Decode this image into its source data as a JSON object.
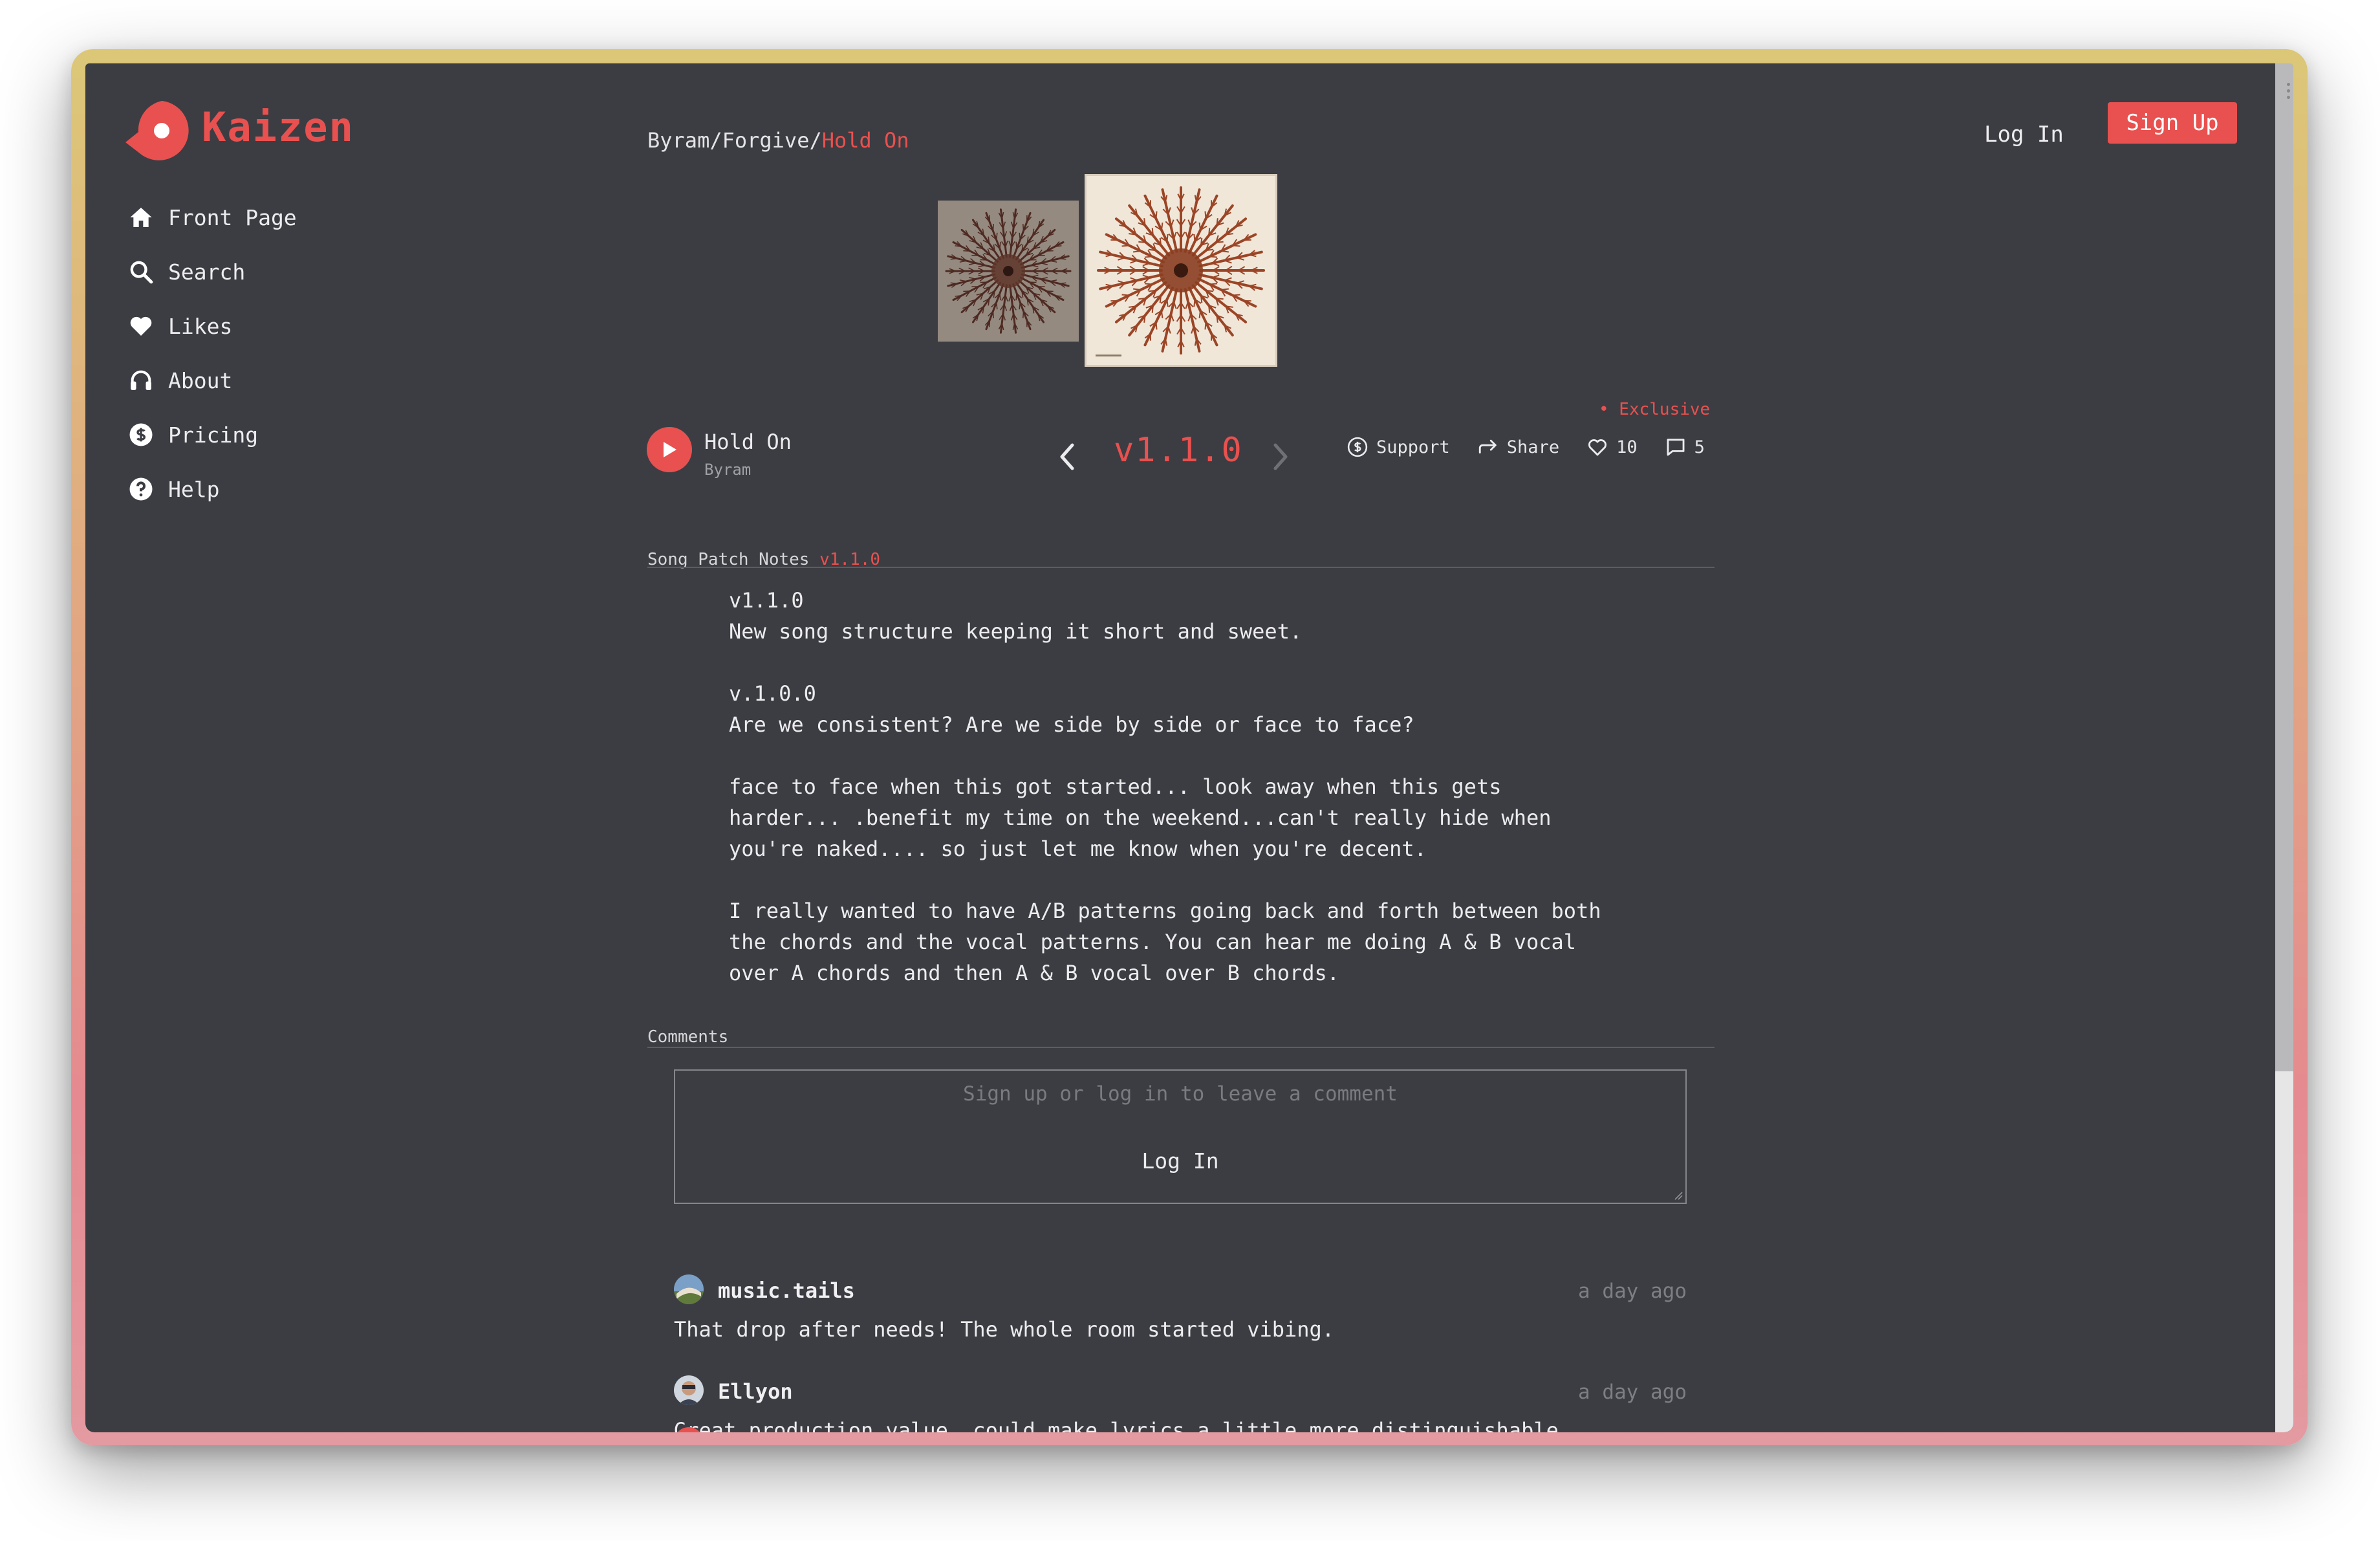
{
  "app": {
    "name": "Kaizen",
    "brand_color": "#e8514f",
    "logo_icon": "kaizen-logo-icon"
  },
  "sidebar": {
    "items": [
      {
        "label": "Front Page",
        "icon": "home-icon"
      },
      {
        "label": "Search",
        "icon": "search-icon"
      },
      {
        "label": "Likes",
        "icon": "heart-icon"
      },
      {
        "label": "About",
        "icon": "headphones-icon"
      },
      {
        "label": "Pricing",
        "icon": "dollar-icon"
      },
      {
        "label": "Help",
        "icon": "help-icon"
      }
    ]
  },
  "header": {
    "breadcrumb": {
      "artist": "Byram",
      "sep1": "/",
      "album": "Forgive",
      "sep2": "/",
      "song": "Hold On"
    },
    "login_label": "Log In",
    "signup_label": "Sign Up"
  },
  "player": {
    "song_title": "Hold On",
    "artist": "Byram",
    "version": "v1.1.0",
    "exclusive_label": "• Exclusive",
    "support_label": "Support",
    "share_label": "Share",
    "likes_count": "10",
    "comments_count": "5"
  },
  "patch_notes": {
    "heading": "Song Patch Notes",
    "version": "v1.1.0",
    "body": "v1.1.0\nNew song structure keeping it short and sweet.\n\nv.1.0.0\nAre we consistent? Are we side by side or face to face?\n\nface to face when this got started... look away when this gets\nharder... .benefit my time on the weekend...can't really hide when\nyou're naked.... so just let me know when you're decent.\n\nI really wanted to have A/B patterns going back and forth between both\nthe chords and the vocal patterns. You can hear me doing A & B vocal\nover A chords and then A & B vocal over B chords."
  },
  "comments": {
    "heading": "Comments",
    "placeholder": "Sign up or log in to leave a comment",
    "login_label": "Log In",
    "items": [
      {
        "user": "music.tails",
        "time": "a day ago",
        "text": "That drop after needs! The whole room started vibing."
      },
      {
        "user": "Ellyon",
        "time": "a day ago",
        "text": "Great production value, could make lyrics a little more distinguishable"
      }
    ]
  }
}
